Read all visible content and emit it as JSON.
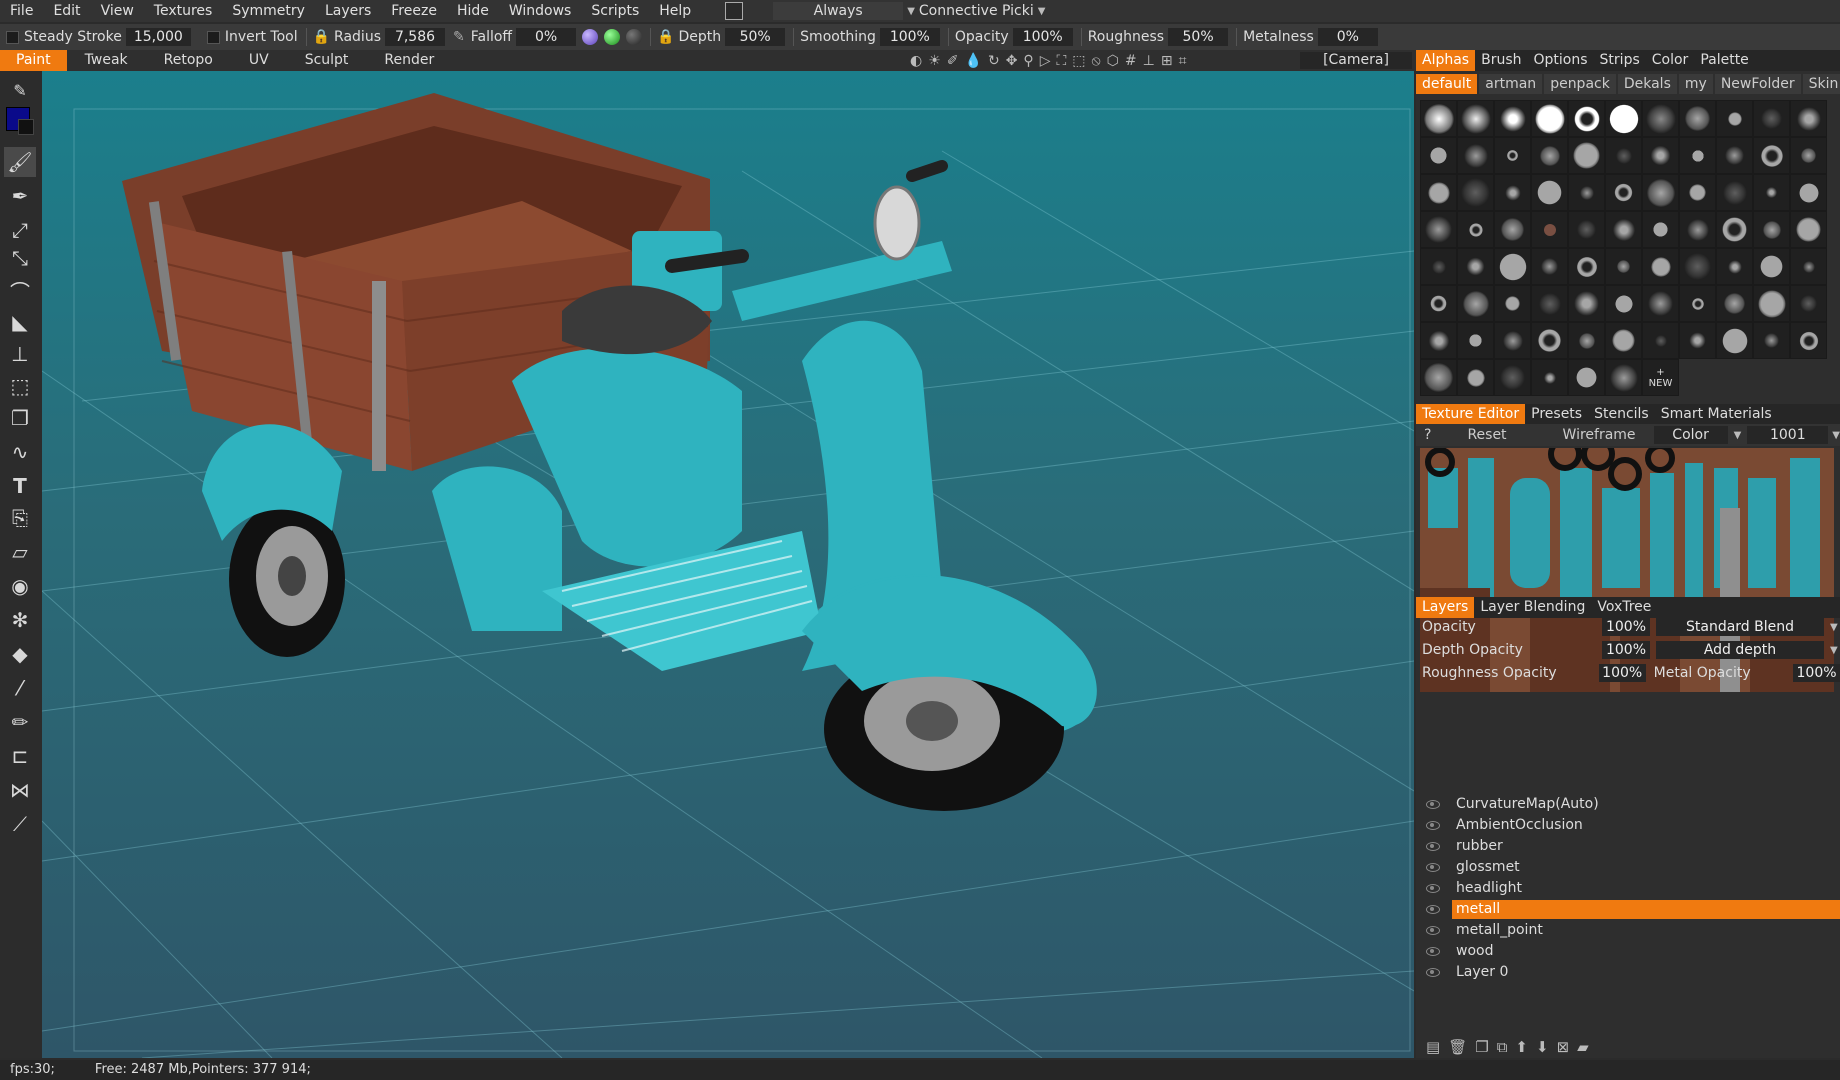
{
  "menu": {
    "items": [
      "File",
      "Edit",
      "View",
      "Textures",
      "Symmetry",
      "Layers",
      "Freeze",
      "Hide",
      "Windows",
      "Scripts",
      "Help"
    ],
    "mode_dropdown": "Always",
    "pick_dropdown": "Connective Picki"
  },
  "options": {
    "steady_stroke_label": "Steady Stroke",
    "steady_stroke_value": "15,000",
    "invert_tool_label": "Invert Tool",
    "radius_label": "Radius",
    "radius_value": "7,586",
    "falloff_label": "Falloff",
    "falloff_value": "0%",
    "depth_label": "Depth",
    "depth_value": "50%",
    "smoothing_label": "Smoothing",
    "smoothing_value": "100%",
    "opacity_label": "Opacity",
    "opacity_value": "100%",
    "roughness_label": "Roughness",
    "roughness_value": "50%",
    "metalness_label": "Metalness",
    "metalness_value": "0%"
  },
  "rooms": [
    "Paint",
    "Tweak",
    "Retopo",
    "UV",
    "Sculpt",
    "Render"
  ],
  "active_room": "Paint",
  "camera": "[Camera]",
  "alphas_panel": {
    "tabs": [
      "Alphas",
      "Brush",
      "Options",
      "Strips",
      "Color",
      "Palette"
    ],
    "subtabs": [
      "default",
      "artman",
      "penpack",
      "Dekals",
      "my",
      "NewFolder",
      "Skin"
    ],
    "new_label": "NEW"
  },
  "texture_editor": {
    "tabs": [
      "Texture Editor",
      "Presets",
      "Stencils",
      "Smart Materials"
    ],
    "help": "?",
    "reset": "Reset",
    "wireframe": "Wireframe",
    "channel": "Color",
    "tile": "1001"
  },
  "layers_panel": {
    "tabs": [
      "Layers",
      "Layer Blending",
      "VoxTree"
    ],
    "opacity_label": "Opacity",
    "opacity_value": "100%",
    "blend_mode": "Standard Blend",
    "depth_opacity_label": "Depth Opacity",
    "depth_opacity_value": "100%",
    "depth_mode": "Add depth",
    "roughness_opacity_label": "Roughness Opacity",
    "roughness_opacity_value": "100%",
    "metal_opacity_label": "Metal Opacity",
    "metal_opacity_value": "100%",
    "layers": [
      "CurvatureMap(Auto)",
      "AmbientOcclusion",
      "rubber",
      "glossmet",
      "headlight",
      "metall",
      "metall_point",
      "wood",
      "Layer 0"
    ],
    "active_layer_index": 5
  },
  "status": {
    "fps": "fps:30;",
    "memory": "Free: 2487 Mb,Pointers: 377 914;"
  },
  "colors": {
    "accent": "#f07a10",
    "scooter": "#2fb3bf",
    "wood": "#8a4a32",
    "primary_color": "#0a0a8a"
  },
  "tool_icons": [
    "brush-icon",
    "pen-icon",
    "airbrush-icon",
    "smudge-icon",
    "clone-icon",
    "fill-icon",
    "stamp-icon",
    "select-icon",
    "copy-icon",
    "curve-icon",
    "text-icon",
    "pick-icon",
    "eraser-icon",
    "eye-icon",
    "gear-icon",
    "bucket-icon",
    "picker-icon",
    "pencil-icon",
    "ruler-icon",
    "symmetry-icon",
    "measure-icon"
  ]
}
